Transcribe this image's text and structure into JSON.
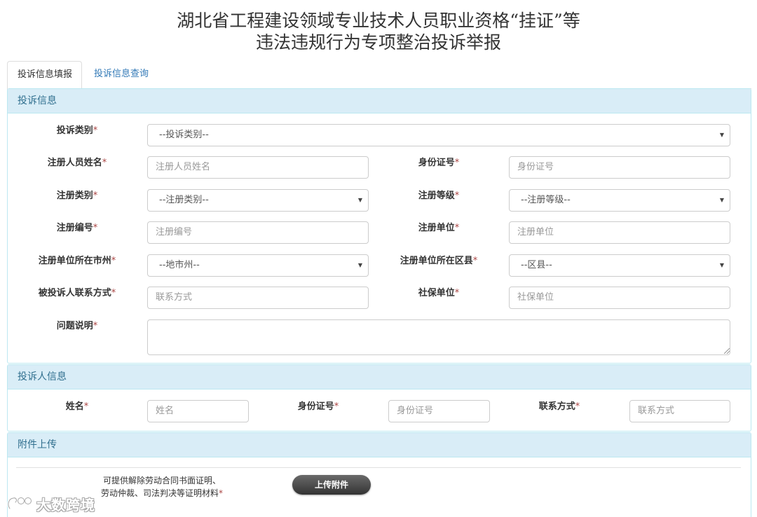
{
  "page": {
    "title_line1": "湖北省工程建设领域专业技术人员职业资格“挂证”等",
    "title_line2": "违法违规行为专项整治投诉举报"
  },
  "tabs": [
    {
      "label": "投诉信息填报",
      "active": true
    },
    {
      "label": "投诉信息查询",
      "active": false
    }
  ],
  "complaint": {
    "heading": "投诉信息",
    "type": {
      "label": "投诉类别",
      "value": "--投诉类别--"
    },
    "reg_name": {
      "label": "注册人员姓名",
      "placeholder": "注册人员姓名"
    },
    "id_no": {
      "label": "身份证号",
      "placeholder": "身份证号"
    },
    "reg_category": {
      "label": "注册类别",
      "value": "--注册类别--"
    },
    "reg_level": {
      "label": "注册等级",
      "value": "--注册等级--"
    },
    "reg_no": {
      "label": "注册编号",
      "placeholder": "注册编号"
    },
    "reg_unit": {
      "label": "注册单位",
      "placeholder": "注册单位"
    },
    "unit_city": {
      "label": "注册单位所在市州",
      "value": "--地市州--"
    },
    "unit_county": {
      "label": "注册单位所在区县",
      "value": "--区县--"
    },
    "contact": {
      "label": "被投诉人联系方式",
      "placeholder": "联系方式"
    },
    "social_unit": {
      "label": "社保单位",
      "placeholder": "社保单位"
    },
    "description": {
      "label": "问题说明",
      "value": ""
    }
  },
  "complainant": {
    "heading": "投诉人信息",
    "name": {
      "label": "姓名",
      "placeholder": "姓名"
    },
    "id_no": {
      "label": "身份证号",
      "placeholder": "身份证号"
    },
    "contact": {
      "label": "联系方式",
      "placeholder": "联系方式"
    }
  },
  "attachment": {
    "heading": "附件上传",
    "note_line1": "可提供解除劳动合同书面证明、",
    "note_line2": "劳动仲裁、司法判决等证明材料",
    "button": "上传附件"
  },
  "common": {
    "required_mark": "*",
    "dropdown_arrow": "▼"
  },
  "watermark": {
    "text": "大数跨境",
    "icon": "brand-logo-icon"
  },
  "colors": {
    "panel_header_bg": "#d9edf7",
    "panel_header_text": "#31708f",
    "panel_border": "#bce8f1",
    "link": "#337ab7",
    "required": "#a94442"
  }
}
